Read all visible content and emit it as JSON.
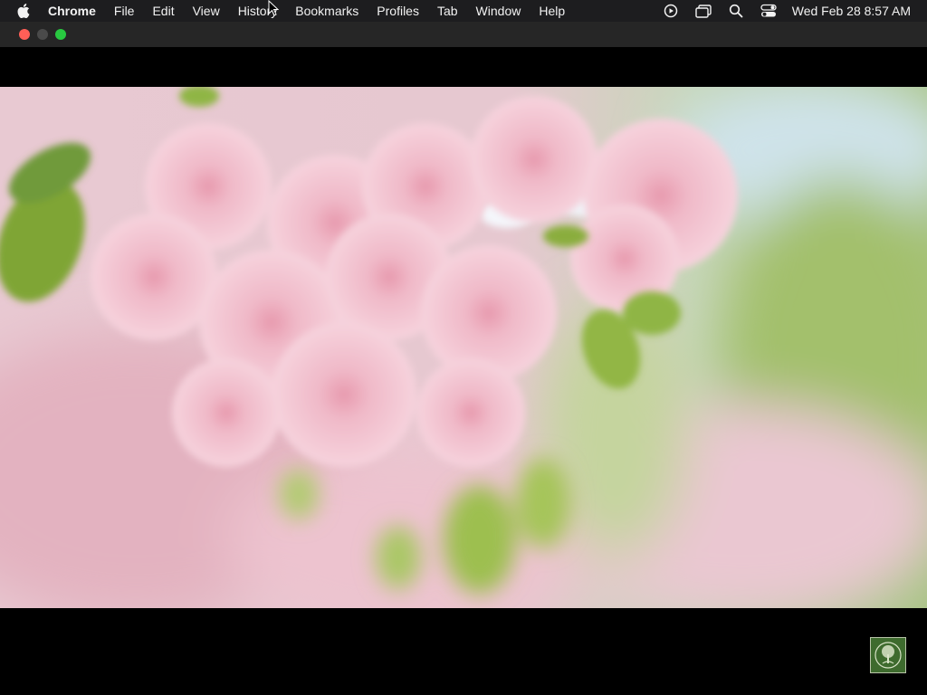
{
  "menubar": {
    "apple_icon": "apple-logo-icon",
    "app_name": "Chrome",
    "items": [
      "File",
      "Edit",
      "View",
      "History",
      "Bookmarks",
      "Profiles",
      "Tab",
      "Window",
      "Help"
    ],
    "status_icons": [
      "screen-recording-icon",
      "screen-mirroring-icon",
      "spotlight-search-icon",
      "control-center-icon"
    ],
    "clock": "Wed Feb 28  8:57 AM"
  },
  "window": {
    "traffic_lights": {
      "close_color": "#ff5f57",
      "minimize_color": "#4a4a4a",
      "zoom_color": "#28c840"
    }
  },
  "video": {
    "content": "pink-cherry-blossom-closeup",
    "channel_logo": "tree-logo-icon"
  }
}
